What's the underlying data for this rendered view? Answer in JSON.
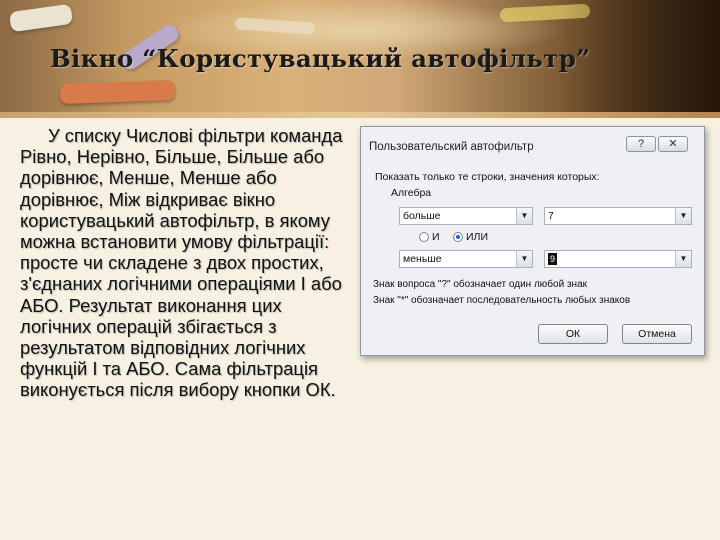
{
  "slide": {
    "title": "Вікно “Користувацький автофільтр”",
    "body": "У списку Числові фільтри команда Рівно, Нерівно, Більше, Більше або дорівнює, Менше, Менше або дорівнює, Між відкриває вікно користувацький автофільтр, в якому можна встановити умову фільтрації: просте чи складене з двох простих, з'єднаних логічними операціями І або АБО. Результат виконання цих логічних операцій збігається з результатом відповідних логічних функцій І та АБО. Сама фільтрація виконується після вибору кнопки ОК."
  },
  "dialog": {
    "title": "Пользовательский автофильтр",
    "help_label": "?",
    "close_label": "✕",
    "caption": "Показать только те строки, значения которых:",
    "group_label": "Алгебра",
    "condition1": {
      "operator": "больше",
      "value": "7"
    },
    "condition2": {
      "operator": "меньше",
      "value": "9"
    },
    "logic": {
      "and_label": "И",
      "or_label": "ИЛИ",
      "selected": "ИЛИ"
    },
    "hint1": "Знак вопроса \"?\" обозначает один любой знак",
    "hint2": "Знак \"*\" обозначает последовательность любых знаков",
    "ok_label": "ОК",
    "cancel_label": "Отмена"
  },
  "icons": {
    "dropdown": "chevron-down-icon",
    "radio": "radio-icon"
  }
}
